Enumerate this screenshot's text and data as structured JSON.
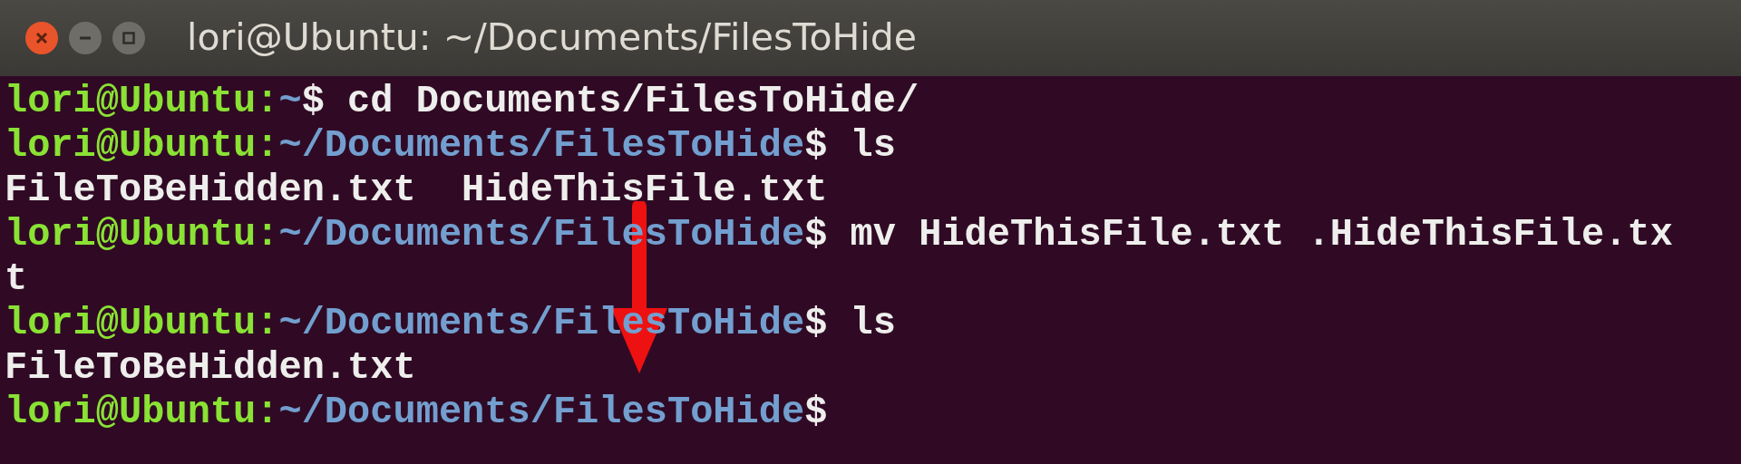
{
  "window": {
    "title": "lori@Ubuntu: ~/Documents/FilesToHide"
  },
  "terminal": {
    "lines": [
      [
        {
          "kind": "user",
          "text": "lori@Ubuntu:"
        },
        {
          "kind": "path",
          "text": "~"
        },
        {
          "kind": "plain",
          "text": "$ cd Documents/FilesToHide/"
        }
      ],
      [
        {
          "kind": "user",
          "text": "lori@Ubuntu:"
        },
        {
          "kind": "path",
          "text": "~/Documents/FilesToHide"
        },
        {
          "kind": "plain",
          "text": "$ ls"
        }
      ],
      [
        {
          "kind": "plain",
          "text": "FileToBeHidden.txt  HideThisFile.txt"
        }
      ],
      [
        {
          "kind": "user",
          "text": "lori@Ubuntu:"
        },
        {
          "kind": "path",
          "text": "~/Documents/FilesToHide"
        },
        {
          "kind": "plain",
          "text": "$ mv HideThisFile.txt .HideThisFile.tx"
        }
      ],
      [
        {
          "kind": "plain",
          "text": "t"
        }
      ],
      [
        {
          "kind": "user",
          "text": "lori@Ubuntu:"
        },
        {
          "kind": "path",
          "text": "~/Documents/FilesToHide"
        },
        {
          "kind": "plain",
          "text": "$ ls"
        }
      ],
      [
        {
          "kind": "plain",
          "text": "FileToBeHidden.txt"
        }
      ],
      [
        {
          "kind": "user",
          "text": "lori@Ubuntu:"
        },
        {
          "kind": "path",
          "text": "~/Documents/FilesToHide"
        },
        {
          "kind": "plain",
          "text": "$"
        }
      ]
    ]
  }
}
